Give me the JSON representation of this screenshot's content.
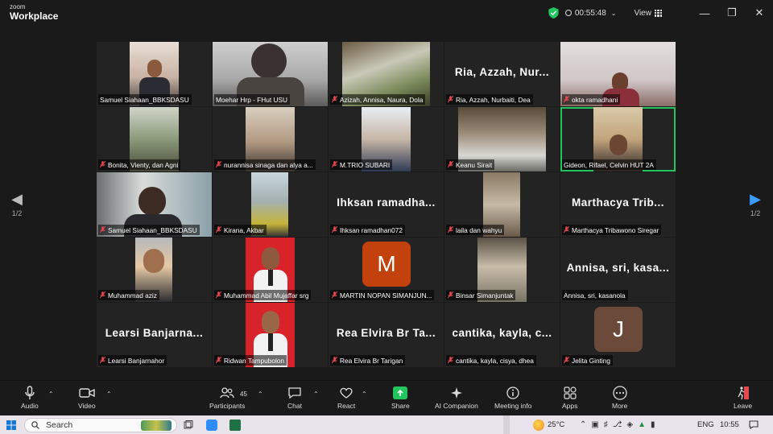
{
  "app": {
    "brand_top": "zoom",
    "brand_bottom": "Workplace"
  },
  "titlebar": {
    "timer": "00:55:48",
    "view_label": "View"
  },
  "pager": {
    "left": "1/2",
    "right": "1/2"
  },
  "tiles": [
    {
      "name": "Samuel Siahaan_BBKSDASU"
    },
    {
      "name": "Moehar Hrp - FHut USU"
    },
    {
      "name": "Azizah, Annisa, Naura, Dola"
    },
    {
      "name": "Ria, Azzah, Nurbaiti, Dea",
      "big": "Ria,  Azzah,  Nur..."
    },
    {
      "name": "okta ramadhani"
    },
    {
      "name": "Bonita, Vienty, dan Agni"
    },
    {
      "name": "nurannisa sinaga dan alya a..."
    },
    {
      "name": "M.TRIO SUBARI"
    },
    {
      "name": "Keanu Sirait"
    },
    {
      "name": "Gideon, Rifael, Celvin HUT 2A"
    },
    {
      "name": "Samuel Siahaan_BBKSDASU"
    },
    {
      "name": "Kirana, Akbar"
    },
    {
      "name": "Ihksan ramadhan072",
      "big": "Ihksan  ramadha..."
    },
    {
      "name": "laila dan wahyu"
    },
    {
      "name": "Marthacya Tribawono Siregar",
      "big": "Marthacya  Trib..."
    },
    {
      "name": "Muhammad aziz"
    },
    {
      "name": "Muhammad Abil Mujaffar srg"
    },
    {
      "name": "MARTIN NOPAN SIMANJUN...",
      "letter": "M"
    },
    {
      "name": "Binsar Simanjuntak"
    },
    {
      "name": "Annisa, sri, kasanola",
      "big": "Annisa,  sri,  kasa..."
    },
    {
      "name": "Learsi Banjarnahor",
      "big": "Learsi  Banjarna..."
    },
    {
      "name": "Ridwan Tampubolon"
    },
    {
      "name": "Rea Elvira Br Tarigan",
      "big": "Rea  Elvira  Br  Ta..."
    },
    {
      "name": "cantika, kayla, cisya, dhea",
      "big": "cantika,  kayla,  c..."
    },
    {
      "name": "Jelita Ginting",
      "letter": "J"
    }
  ],
  "toolbar": {
    "audio": "Audio",
    "video": "Video",
    "participants": "Participants",
    "participants_count": "45",
    "chat": "Chat",
    "react": "React",
    "share": "Share",
    "ai": "AI Companion",
    "meeting_info": "Meeting info",
    "apps": "Apps",
    "more": "More",
    "leave": "Leave"
  },
  "taskbar": {
    "search": "Search",
    "temp": "25°C",
    "lang": "ENG",
    "time": "10:55"
  }
}
